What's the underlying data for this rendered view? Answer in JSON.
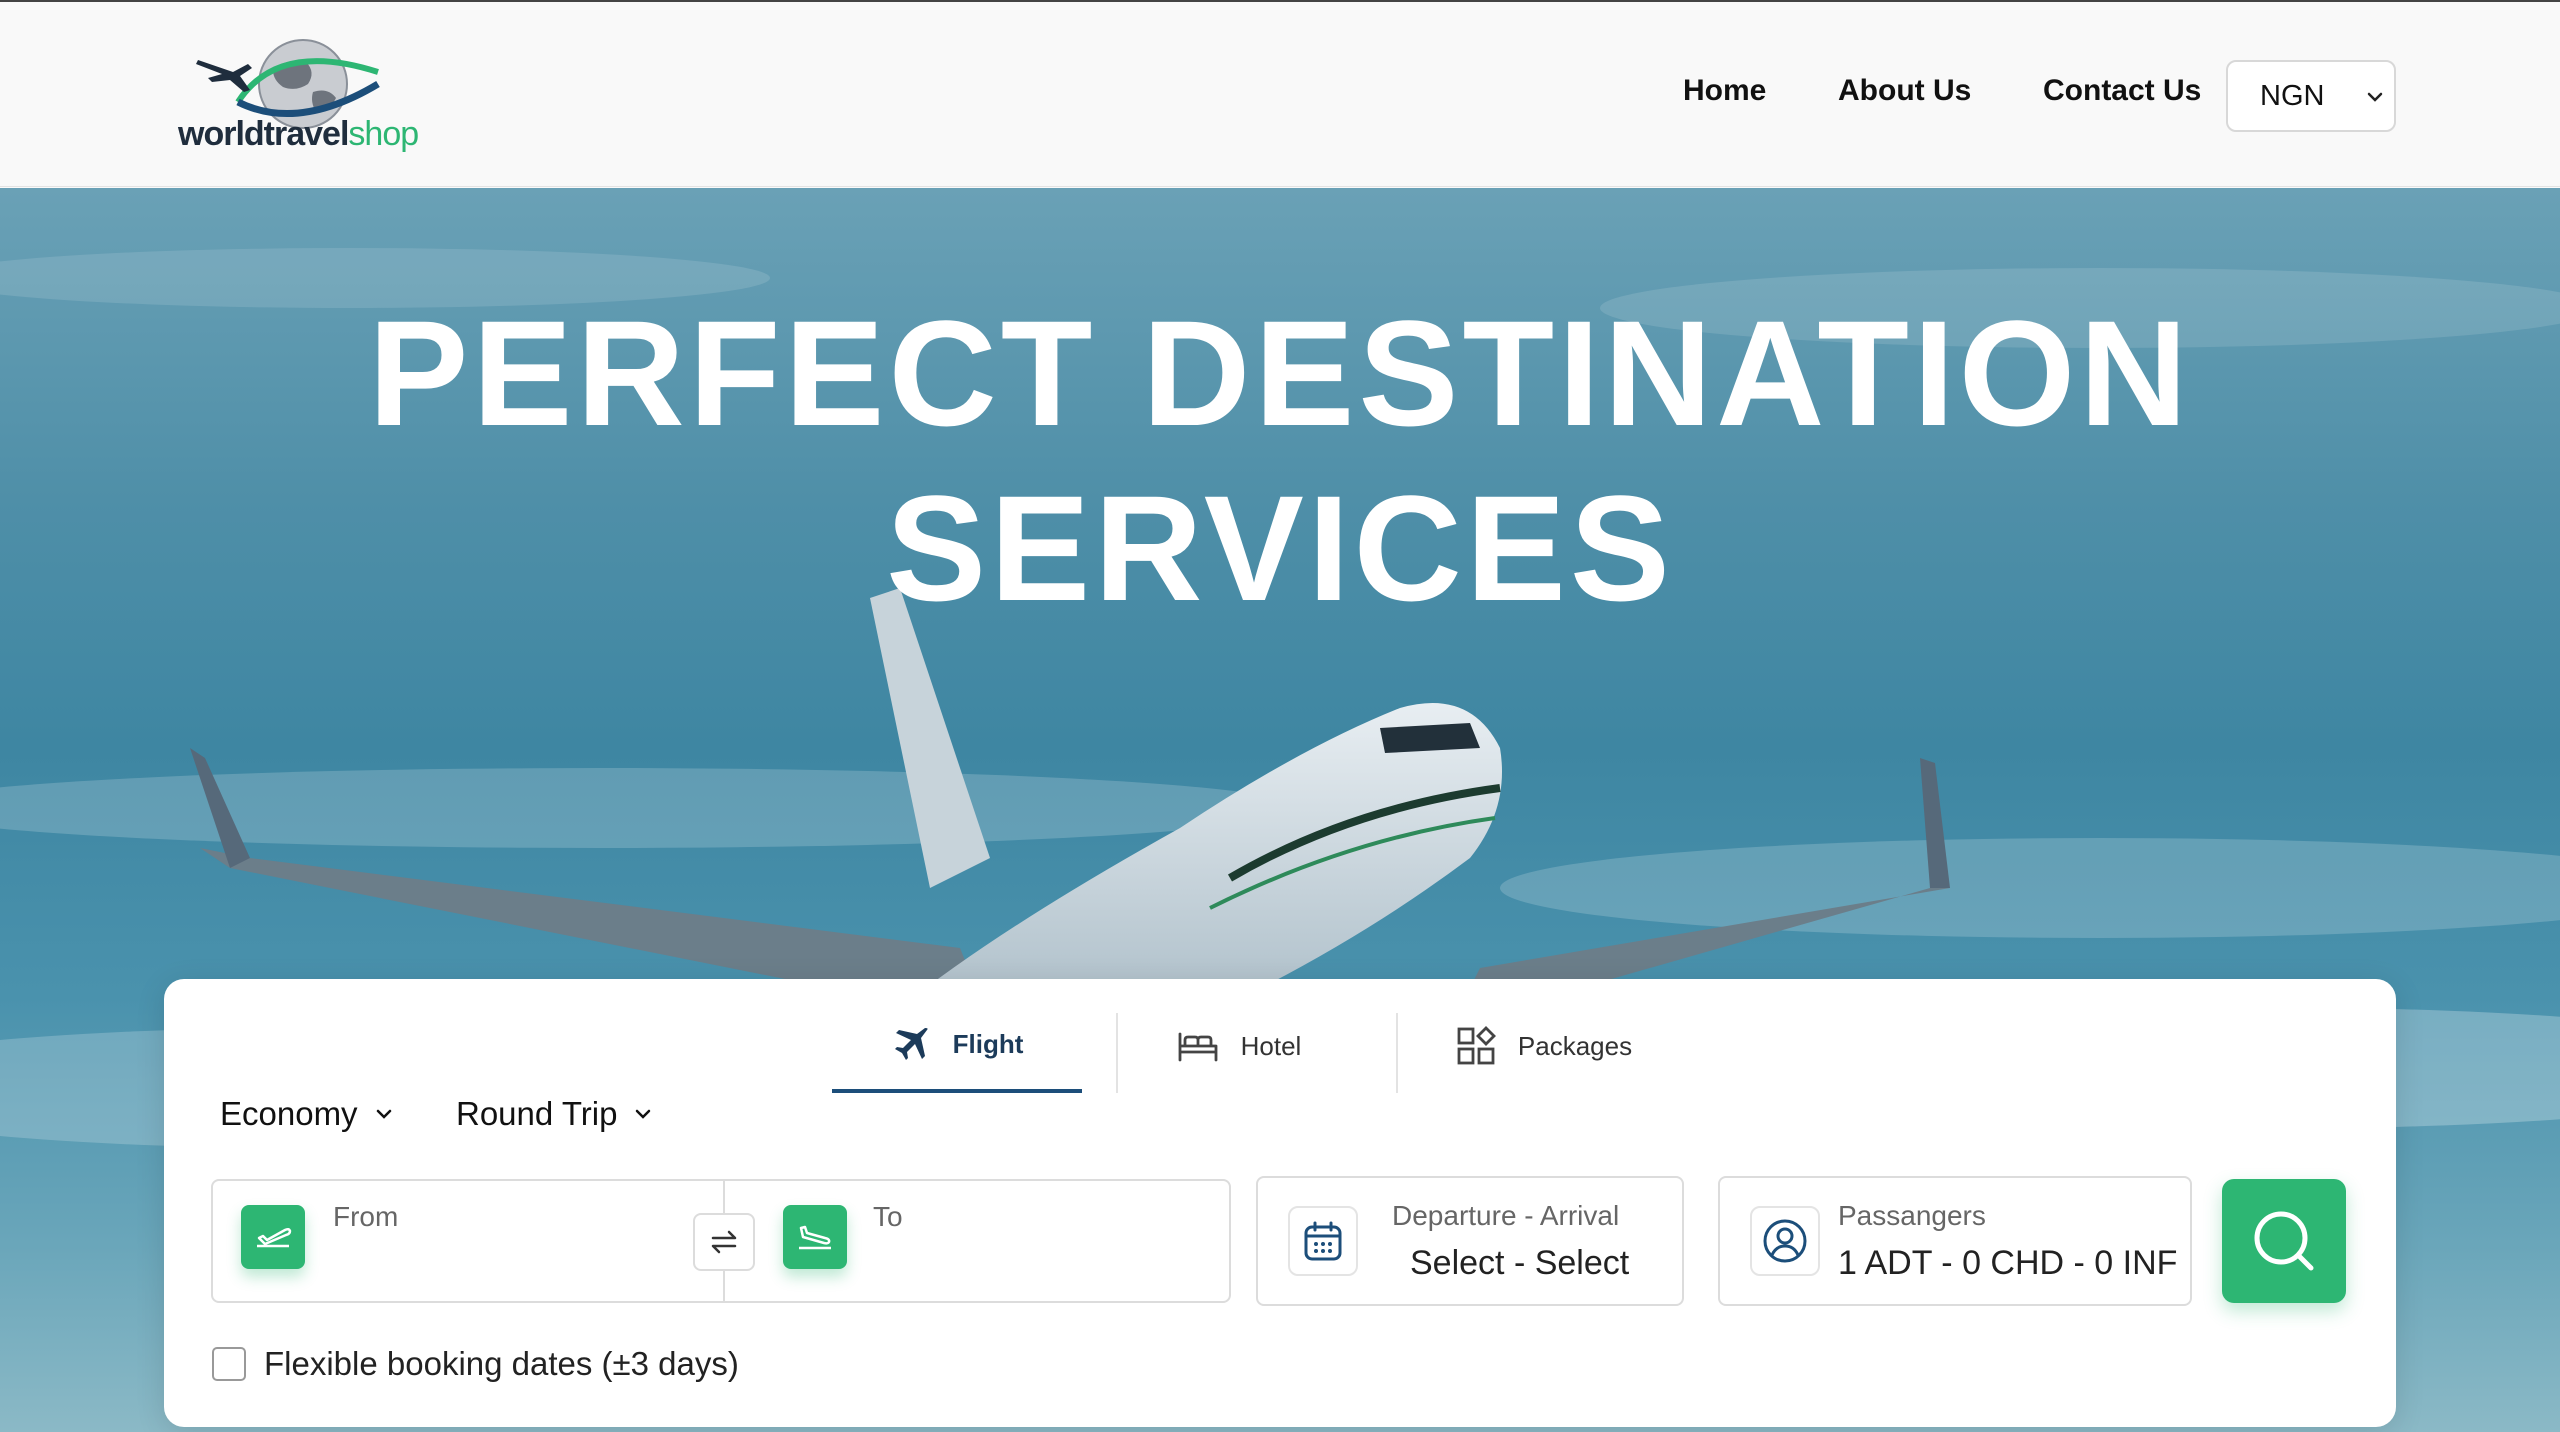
{
  "header": {
    "logo": {
      "word1": "world",
      "word2": "travel",
      "word3": "shop"
    },
    "nav": [
      "Home",
      "About Us",
      "Contact Us"
    ],
    "currency": "NGN"
  },
  "hero": {
    "title_line1": "PERFECT DESTINATION",
    "title_line2": "SERVICES"
  },
  "search": {
    "tabs": [
      "Flight",
      "Hotel",
      "Packages"
    ],
    "active_tab": "Flight",
    "cabin_class": "Economy",
    "trip_type": "Round Trip",
    "from_label": "From",
    "to_label": "To",
    "dates_label": "Departure - Arrival",
    "dates_value": "Select - Select",
    "passengers_label": "Passangers",
    "passengers_value": "1 ADT - 0 CHD - 0 INF",
    "flexible_label": "Flexible booking dates (±3 days)",
    "flexible_checked": false
  },
  "colors": {
    "accent_green": "#2db673",
    "navy": "#1c4e7a",
    "sky": "#3e86a2"
  },
  "icons": {
    "flight_tab": "airplane-icon",
    "hotel_tab": "bed-icon",
    "packages_tab": "grid-icon",
    "from": "takeoff-icon",
    "to": "landing-icon",
    "swap": "swap-arrows-icon",
    "dates": "calendar-icon",
    "passengers": "user-icon",
    "search": "search-icon"
  }
}
